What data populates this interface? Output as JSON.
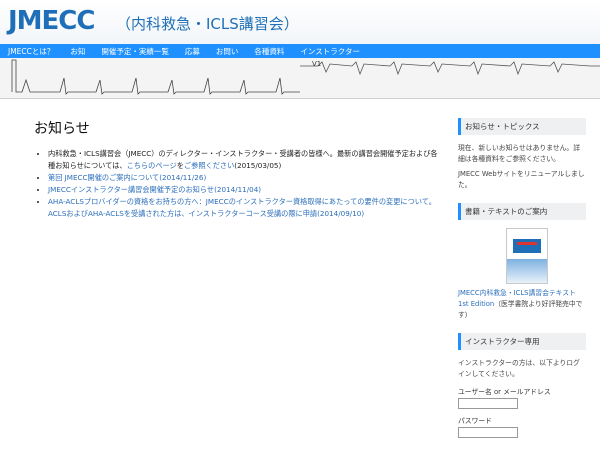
{
  "header": {
    "logo": "JMECC",
    "subtitle": "（内科救急・ICLS講習会）"
  },
  "nav": {
    "items": [
      {
        "label": "JMECCとは？"
      },
      {
        "label": "お知"
      },
      {
        "label": "開催予定・実績一覧"
      },
      {
        "label": "応募"
      },
      {
        "label": "お問い"
      },
      {
        "label": "各種資料"
      },
      {
        "label": "インストラクター"
      }
    ]
  },
  "ecg": {
    "lead_label": "V1"
  },
  "main": {
    "title": "お知らせ",
    "news": [
      {
        "text": "内科救急・ICLS講習会（JMECC）のディレクター・インストラクター・受講者の皆様へ。最新の講習会開催予定および各種お知らせについては、",
        "link1": "こちらのページ",
        "mid": "を",
        "link2": "ご参照ください",
        "date": "(2015/03/05)"
      },
      {
        "link": "第回 JMECC開催のご案内について(2014/11/26)"
      },
      {
        "link": "JMECCインストラクター講習会開催予定のお知らせ(2014/11/04)"
      },
      {
        "link": "AHA-ACLSプロバイダーの資格をお持ちの方へ：JMECCのインストラクター資格取得にあたっての要件の変更について。ACLSおよびAHA-ACLSを受講された方は、インストラクターコース受講の際に申請(2014/09/10)"
      }
    ]
  },
  "sidebar": {
    "widgets": [
      {
        "title": "お知らせ・トピックス",
        "lines": [
          "現在、新しいお知らせはありません。詳細は各種資料をご参照ください。",
          "JMECC Webサイトをリニューアルしました。"
        ]
      },
      {
        "title": "書籍・テキストのご案内",
        "book_caption_link": "JMECC内科救急・ICLS講習会テキスト 1st Edition",
        "book_caption_rest": "（医学書院より好評発売中です）"
      },
      {
        "title": "インストラクター専用",
        "intro": "インストラクターの方は、以下よりログインしてください。",
        "user_label": "ユーザー名 or メールアドレス",
        "user_value": "",
        "pass_label": "パスワード",
        "pass_value": ""
      }
    ]
  },
  "colors": {
    "accent": "#1e90ff",
    "logo": "#1f6fb8",
    "link": "#2a6ebb"
  }
}
